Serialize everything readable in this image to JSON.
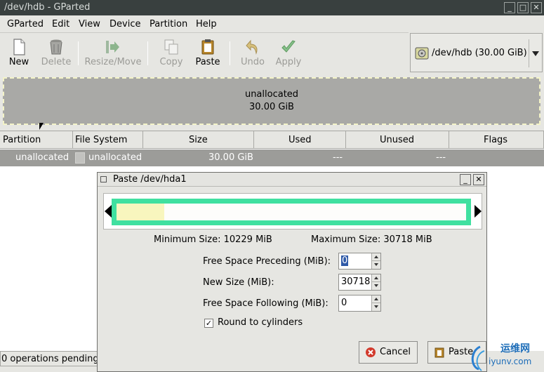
{
  "window": {
    "title": "/dev/hdb - GParted"
  },
  "menu": [
    "GParted",
    "Edit",
    "View",
    "Device",
    "Partition",
    "Help"
  ],
  "toolbar": {
    "new": "New",
    "delete": "Delete",
    "resize_move": "Resize/Move",
    "copy": "Copy",
    "paste": "Paste",
    "undo": "Undo",
    "apply": "Apply"
  },
  "device_selector": {
    "label": "/dev/hdb   (30.00 GiB)"
  },
  "disk_map": {
    "name": "unallocated",
    "size": "30.00 GiB"
  },
  "columns": {
    "partition": "Partition",
    "file_system": "File System",
    "size": "Size",
    "used": "Used",
    "unused": "Unused",
    "flags": "Flags"
  },
  "rows": [
    {
      "partition": "unallocated",
      "file_system": "unallocated",
      "size": "30.00 GiB",
      "used": "---",
      "unused": "---",
      "flags": ""
    }
  ],
  "status": "0 operations pending",
  "dialog": {
    "title": "Paste /dev/hda1",
    "min_size": "Minimum Size: 10229 MiB",
    "max_size": "Maximum Size: 30718 MiB",
    "free_preceding_label": "Free Space Preceding (MiB):",
    "free_preceding_value": "0",
    "new_size_label": "New Size (MiB):",
    "new_size_value": "30718",
    "free_following_label": "Free Space Following (MiB):",
    "free_following_value": "0",
    "round_label": "Round to cylinders",
    "round_checked": true,
    "cancel": "Cancel",
    "paste": "Paste"
  },
  "watermark": {
    "line1": "运维网",
    "line2": "iyunv.com"
  }
}
